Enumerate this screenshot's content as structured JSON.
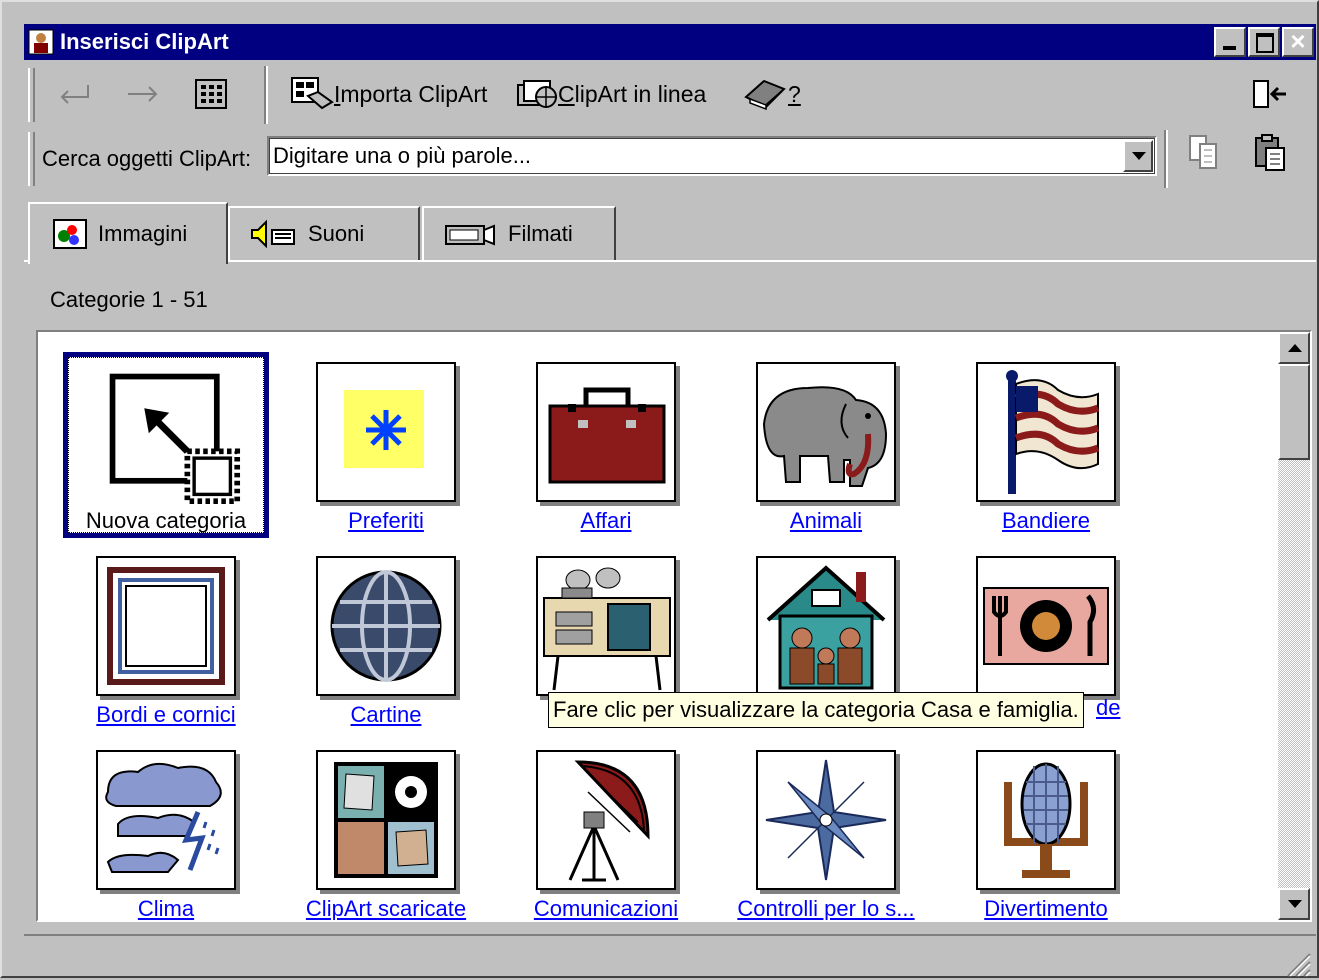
{
  "window": {
    "title": "Inserisci ClipArt"
  },
  "toolbar": {
    "back_icon": "back-arrow-icon",
    "forward_icon": "forward-arrow-icon",
    "import_label_first": "I",
    "import_label_rest": "mporta ClipArt",
    "online_label_first": "C",
    "online_label_rest": "lipArt in linea",
    "help_label": "?"
  },
  "search": {
    "label": "Cerca oggetti ClipArt:",
    "value": "Digitare una o più parole..."
  },
  "tabs": [
    {
      "label": "Immagini",
      "icon": "pictures-icon"
    },
    {
      "label": "Suoni",
      "icon": "sounds-icon"
    },
    {
      "label": "Filmati",
      "icon": "movies-icon"
    }
  ],
  "category_count": "Categorie 1 - 51",
  "categories": [
    {
      "label": "Nuova categoria",
      "icon": "new-category-icon"
    },
    {
      "label": "Preferiti",
      "icon": "favorites-icon"
    },
    {
      "label": "Affari",
      "icon": "briefcase-icon"
    },
    {
      "label": "Animali",
      "icon": "elephant-icon"
    },
    {
      "label": "Bandiere",
      "icon": "flag-icon"
    },
    {
      "label": "Bordi e cornici",
      "icon": "frame-icon"
    },
    {
      "label": "Cartine",
      "icon": "globe-icon"
    },
    {
      "label": "",
      "icon": "kitchen-icon"
    },
    {
      "label": "",
      "icon": "house-family-icon"
    },
    {
      "label": "",
      "icon": "dining-icon"
    },
    {
      "label": "Clima",
      "icon": "storm-cloud-icon"
    },
    {
      "label": "ClipArt scaricate",
      "icon": "downloaded-clipart-icon"
    },
    {
      "label": "Comunicazioni",
      "icon": "satellite-dish-icon"
    },
    {
      "label": "Controlli per lo s...",
      "icon": "compass-star-icon"
    },
    {
      "label": "Divertimento",
      "icon": "microphone-icon"
    }
  ],
  "tooltip": "Fare clic per visualizzare la categoria Casa e famiglia.",
  "tooltip_tail": "de"
}
